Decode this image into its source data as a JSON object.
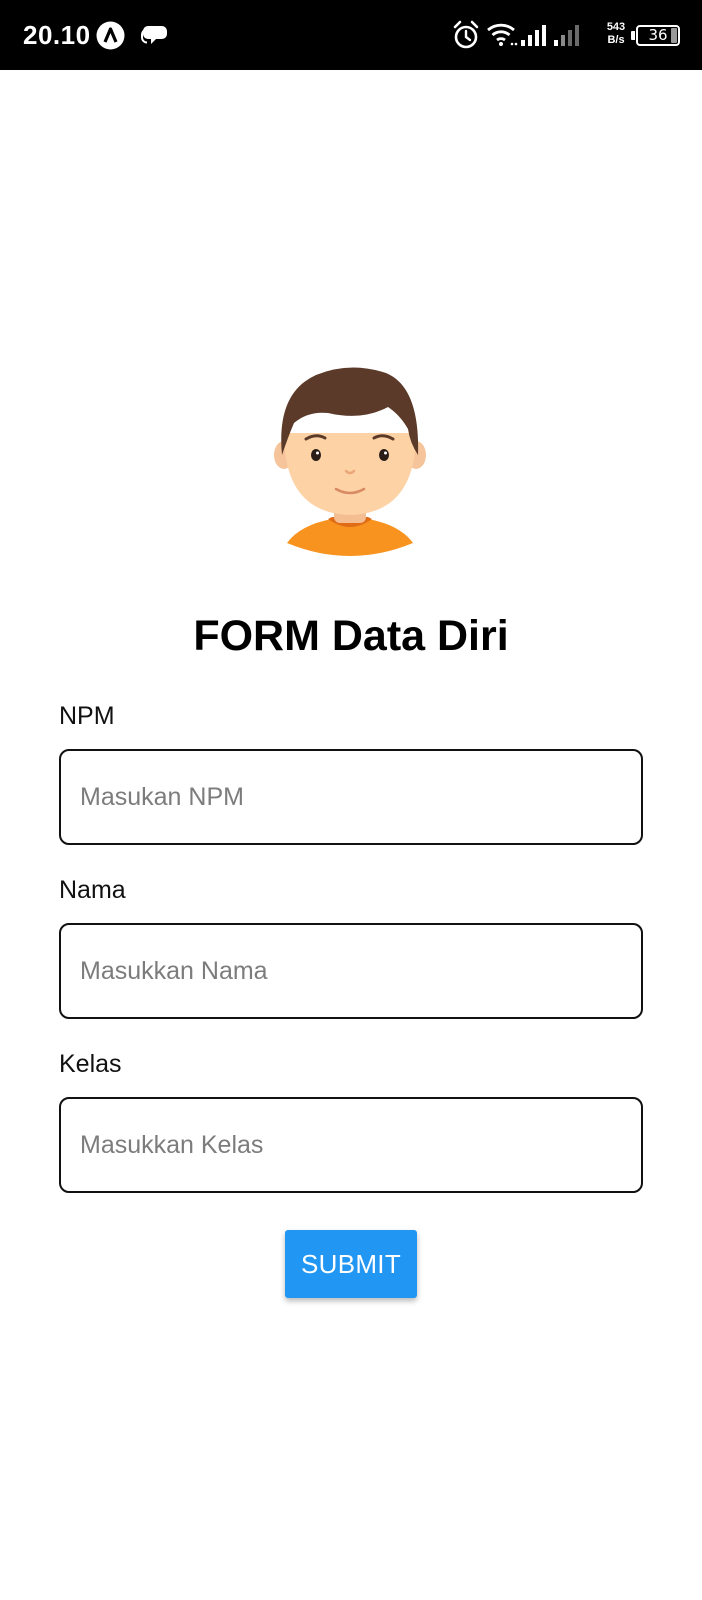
{
  "status_bar": {
    "time": "20.10",
    "net_speed_value": "543",
    "net_speed_unit": "B/s",
    "battery_level": "36",
    "icons": [
      "autonavi-app-icon",
      "chat-bubbles-icon",
      "alarm-icon",
      "wifi-icon",
      "signal-sim1-icon",
      "signal-sim2-icon",
      "battery-icon"
    ]
  },
  "form": {
    "title": "FORM Data Diri",
    "avatar_icon": "boy-avatar-icon",
    "fields": [
      {
        "label": "NPM",
        "placeholder": "Masukan NPM",
        "value": ""
      },
      {
        "label": "Nama",
        "placeholder": "Masukkan Nama",
        "value": ""
      },
      {
        "label": "Kelas",
        "placeholder": "Masukkan Kelas",
        "value": ""
      }
    ],
    "submit_label": "SUBMIT"
  },
  "colors": {
    "accent": "#2196f3",
    "status_bar_bg": "#000000",
    "avatar_hair": "#5b3a29",
    "avatar_skin": "#fdd2a5",
    "avatar_shirt": "#f7931e"
  }
}
